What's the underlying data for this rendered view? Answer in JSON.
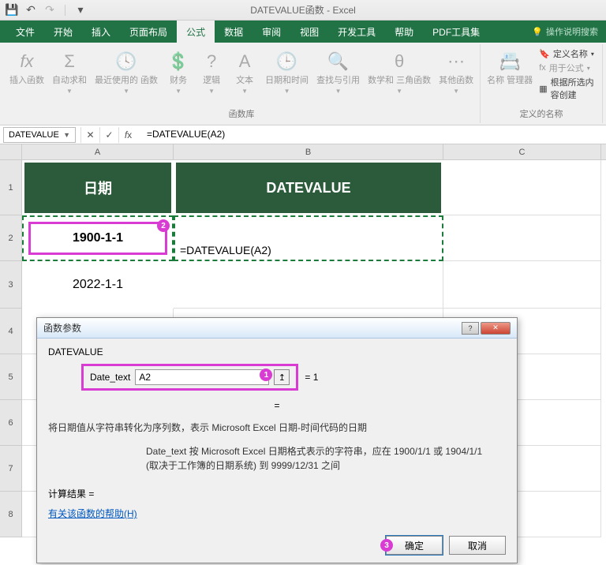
{
  "title": "DATEVALUE函数 - Excel",
  "tabs": {
    "file": "文件",
    "home": "开始",
    "insert": "插入",
    "page": "页面布局",
    "formula": "公式",
    "data": "数据",
    "review": "审阅",
    "view": "视图",
    "dev": "开发工具",
    "help": "帮助",
    "pdf": "PDF工具集",
    "tellme": "操作说明搜索"
  },
  "ribbon": {
    "insert_fn": "插入函数",
    "autosum": "自动求和",
    "recent": "最近使用的\n函数",
    "financial": "财务",
    "logical": "逻辑",
    "text": "文本",
    "datetime": "日期和时间",
    "lookup": "查找与引用",
    "math": "数学和\n三角函数",
    "more": "其他函数",
    "group1": "函数库",
    "name_mgr": "名称\n管理器",
    "defname": "定义名称",
    "usefml": "用于公式",
    "create": "根据所选内容创建",
    "group2": "定义的名称"
  },
  "namebox": "DATEVALUE",
  "formula": "=DATEVALUE(A2)",
  "columns": {
    "A": "A",
    "B": "B",
    "C": "C"
  },
  "headers": {
    "date": "日期",
    "dv": "DATEVALUE"
  },
  "cells": {
    "A2": "1900-1-1",
    "A3": "2022-1-1",
    "B2": "=DATEVALUE(A2)"
  },
  "dialog": {
    "title": "函数参数",
    "fn": "DATEVALUE",
    "arglabel": "Date_text",
    "argvalue": "A2",
    "eq1": "= 1",
    "eqmid": "=",
    "desc": "将日期值从字符串转化为序列数，表示 Microsoft Excel 日期-时间代码的日期",
    "arghelp": "Date_text  按 Microsoft Excel 日期格式表示的字符串，应在 1900/1/1 或 1904/1/1 (取决于工作簿的日期系统) 到 9999/12/31 之间",
    "result": "计算结果 =",
    "helplink": "有关该函数的帮助(H)",
    "ok": "确定",
    "cancel": "取消"
  },
  "callouts": {
    "c1": "1",
    "c2": "2",
    "c3": "3"
  }
}
